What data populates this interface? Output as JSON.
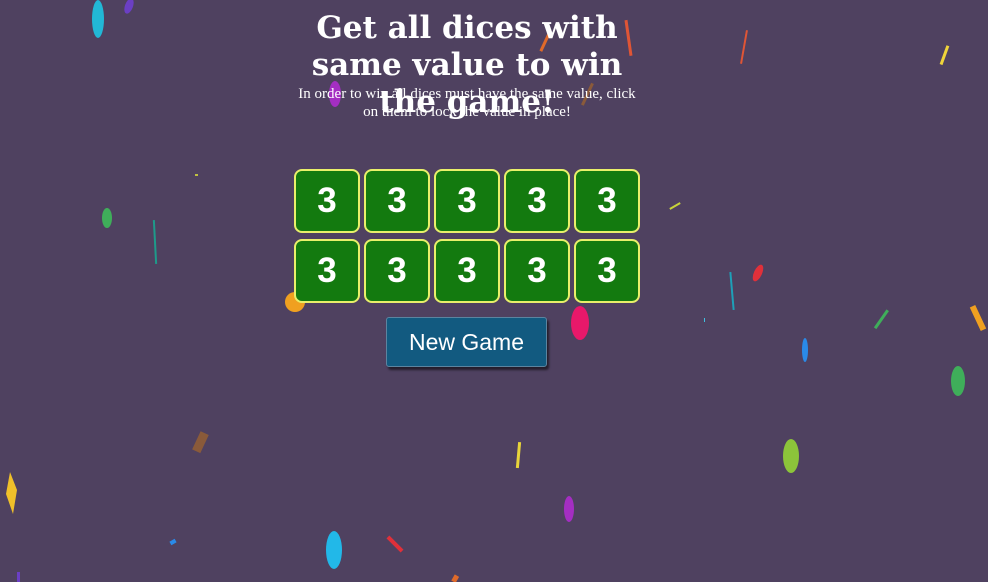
{
  "game": {
    "title": "Get all dices with same value to win the game!",
    "instructions": "In order to win all dices must have the same value, click on them to lock the value in place!",
    "dice": [
      3,
      3,
      3,
      3,
      3,
      3,
      3,
      3,
      3,
      3
    ],
    "new_game_label": "New Game"
  },
  "colors": {
    "background": "#4f4160",
    "die_fill": "#137a0f",
    "die_border": "#e9f06a",
    "button_fill": "#125a80"
  }
}
